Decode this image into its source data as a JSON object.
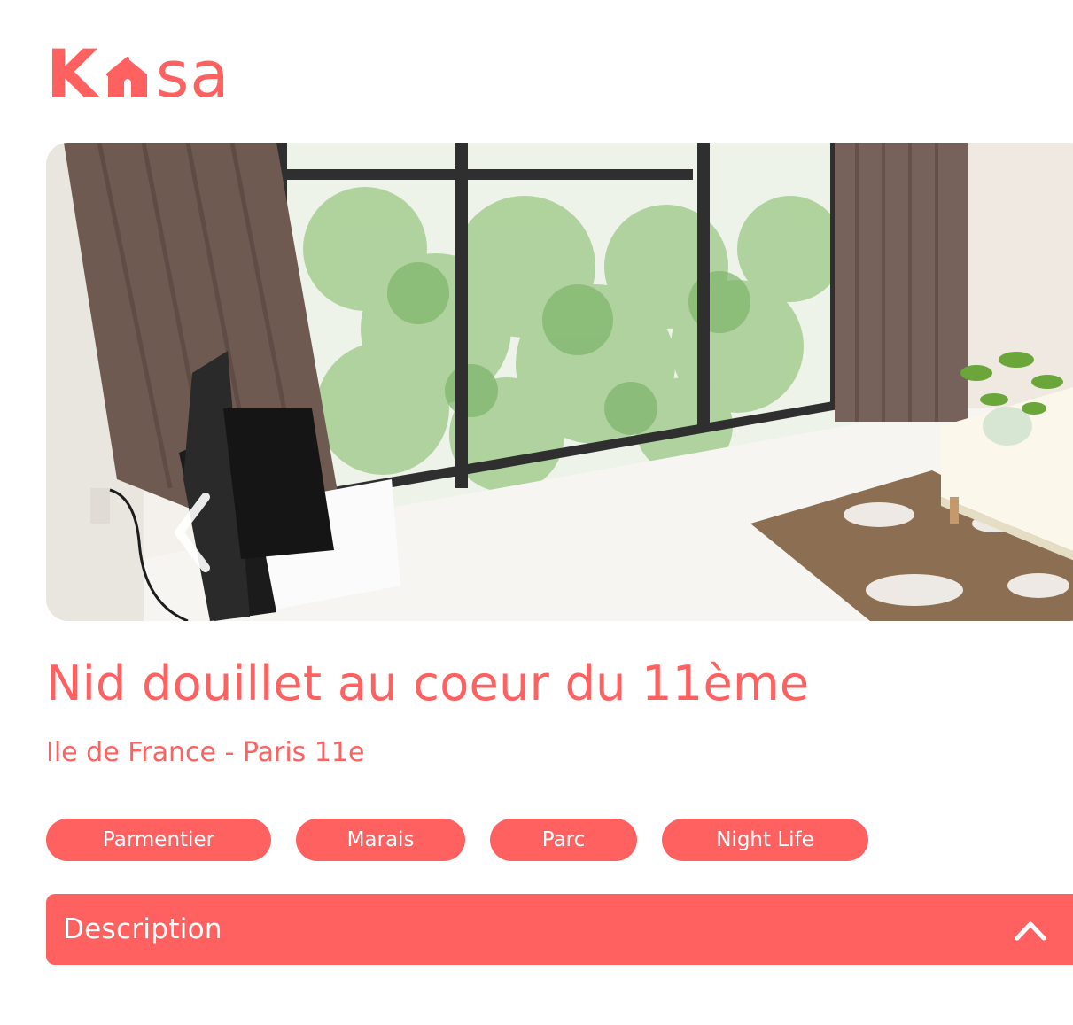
{
  "brand": {
    "logo_letter_1": "K",
    "logo_letters_rest": "sa",
    "logo_icon": "house-icon",
    "accent_color": "#FF6060"
  },
  "gallery": {
    "image_description_icon": "apartment-photo",
    "prev_arrow_icon": "chevron-left-icon"
  },
  "listing": {
    "title": "Nid douillet au coeur du 11ème",
    "location": "Ile de France - Paris 11e",
    "tags": [
      "Parmentier",
      "Marais",
      "Parc",
      "Night Life"
    ]
  },
  "description": {
    "label": "Description",
    "toggle_icon": "chevron-up-icon",
    "expanded": false
  }
}
